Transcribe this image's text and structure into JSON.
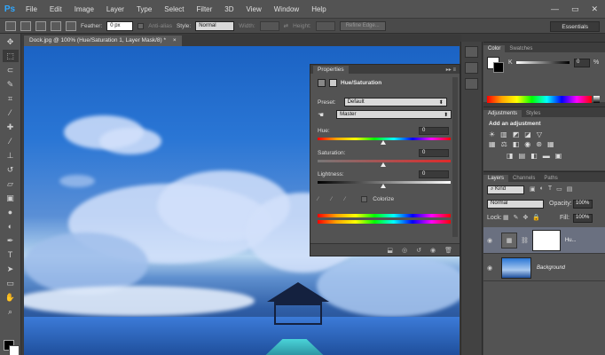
{
  "app": {
    "logo": "Ps"
  },
  "menu": [
    "File",
    "Edit",
    "Image",
    "Layer",
    "Type",
    "Select",
    "Filter",
    "3D",
    "View",
    "Window",
    "Help"
  ],
  "window_controls": [
    "—",
    "▭",
    "✕"
  ],
  "options": {
    "feather_label": "Feather:",
    "feather_value": "0 px",
    "antialias_label": "Anti-alias",
    "style_label": "Style:",
    "style_value": "Normal",
    "width_label": "Width:",
    "height_label": "Height:",
    "refine_edge": "Refine Edge...",
    "workspace": "Essentials"
  },
  "document": {
    "tab_title": "Dock.jpg @ 100% (Hue/Saturation 1, Layer Mask/8) *"
  },
  "properties": {
    "tab": "Properties",
    "header_ctrls": "▸▸ ≡",
    "adjustment_title": "Hue/Saturation",
    "preset_label": "Preset:",
    "preset_value": "Default",
    "channel_value": "Master",
    "hue_label": "Hue:",
    "hue_value": "0",
    "saturation_label": "Saturation:",
    "saturation_value": "0",
    "lightness_label": "Lightness:",
    "lightness_value": "0",
    "colorize_label": "Colorize"
  },
  "color_panel": {
    "tabs": [
      "Color",
      "Swatches"
    ],
    "k_label": "K",
    "k_value": "0",
    "k_unit": "%"
  },
  "adjustments_panel": {
    "tabs": [
      "Adjustments",
      "Styles"
    ],
    "heading": "Add an adjustment"
  },
  "layers_panel": {
    "tabs": [
      "Layers",
      "Channels",
      "Paths"
    ],
    "kind_value": "Kind",
    "blend_mode": "Normal",
    "opacity_label": "Opacity:",
    "opacity_value": "100%",
    "lock_label": "Lock:",
    "fill_label": "Fill:",
    "fill_value": "100%",
    "layers": [
      {
        "name": "Hu...",
        "selected": true
      },
      {
        "name": "Background",
        "selected": false
      }
    ]
  }
}
